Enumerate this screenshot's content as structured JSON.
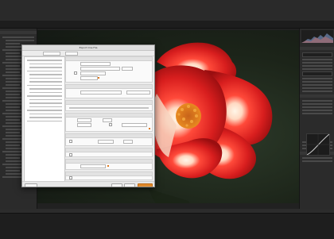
{
  "dialog": {
    "title": "Export One File"
  },
  "colors": {
    "app_background": "#262626",
    "dialog_background": "#ececec",
    "accent_button": "#e08a2c",
    "petal_red": "#d81e1e",
    "stamen_orange": "#e88a20"
  },
  "icons": [
    "histogram-icon",
    "tone-curve-icon",
    "checkbox-icon"
  ]
}
